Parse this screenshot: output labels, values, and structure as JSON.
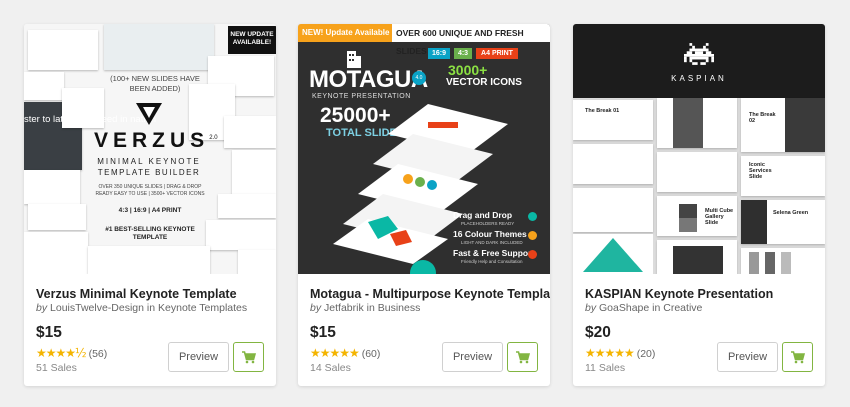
{
  "cards": [
    {
      "title": "Verzus Minimal Keynote Template",
      "by": "by",
      "author": "LouisTwelve-Design",
      "in": "in",
      "category": "Keynote Templates",
      "price": "$15",
      "stars": "★★★★½",
      "reviews": "(56)",
      "sales": "51 Sales",
      "preview_label": "Preview",
      "thumb": {
        "badge": "NEW UPDATE AVAILABLE!",
        "headline": "(100+ NEW SLIDES HAVE BEEN ADDED)",
        "brand": "VERZUS",
        "version": "2.0",
        "sub1": "MINIMAL KEYNOTE",
        "sub2": "TEMPLATE BUILDER",
        "features": "OVER 350 UNIQUE SLIDES | DRAG & DROP READY EASY TO USE | 3500+ VECTOR ICONS",
        "formats": "4:3 | 16:9 | A4 PRINT",
        "best": "#1 BEST-SELLING KEYNOTE TEMPLATE",
        "side_text": "ster to late your cceed in nation"
      }
    },
    {
      "title": "Motagua - Multipurpose Keynote Template",
      "by": "by",
      "author": "Jetfabrik",
      "in": "in",
      "category": "Business",
      "price": "$15",
      "stars": "★★★★★",
      "reviews": "(60)",
      "sales": "14 Sales",
      "preview_label": "Preview",
      "thumb": {
        "new": "NEW! Update Available",
        "over": "OVER 600 UNIQUE AND FRESH SLIDES",
        "tag1": "16:9",
        "tag2": "4:3",
        "tag3": "A4 PRINT",
        "brand": "MOTAGUA",
        "version": "4.0",
        "keynote": "KEYNOTE PRESENTATION",
        "slides_num": "25000+",
        "total": "TOTAL SLIDES",
        "icons_num": "3000+",
        "icons_txt": "VECTOR ICONS",
        "f1": "Drag and Drop",
        "f1_sub": "PLACEHOLDERS READY",
        "f2": "16 Colour Themes",
        "f2_sub": "LIGHT AND DARK INCLUDED",
        "f3": "Fast & Free Support",
        "f3_sub": "Friendly Help and Consultation"
      }
    },
    {
      "title": "KASPIAN Keynote Presentation",
      "by": "by",
      "author": "GoaShape",
      "in": "in",
      "category": "Creative",
      "price": "$20",
      "stars": "★★★★★",
      "reviews": "(20)",
      "sales": "11 Sales",
      "preview_label": "Preview",
      "thumb": {
        "brand": "KASPIAN",
        "s1": "The Break 01",
        "s2": "The Break 02",
        "s3": "Iconic Services Slide",
        "s4": "Multi Cube Gallery Slide",
        "s5": "Selena Green"
      }
    }
  ],
  "colors": {
    "cart_green": "#82b541",
    "star": "#f4b400"
  },
  "icons": [
    "cart-icon",
    "star-icon",
    "verzus-logo-icon",
    "building-icon",
    "space-invader-icon"
  ]
}
